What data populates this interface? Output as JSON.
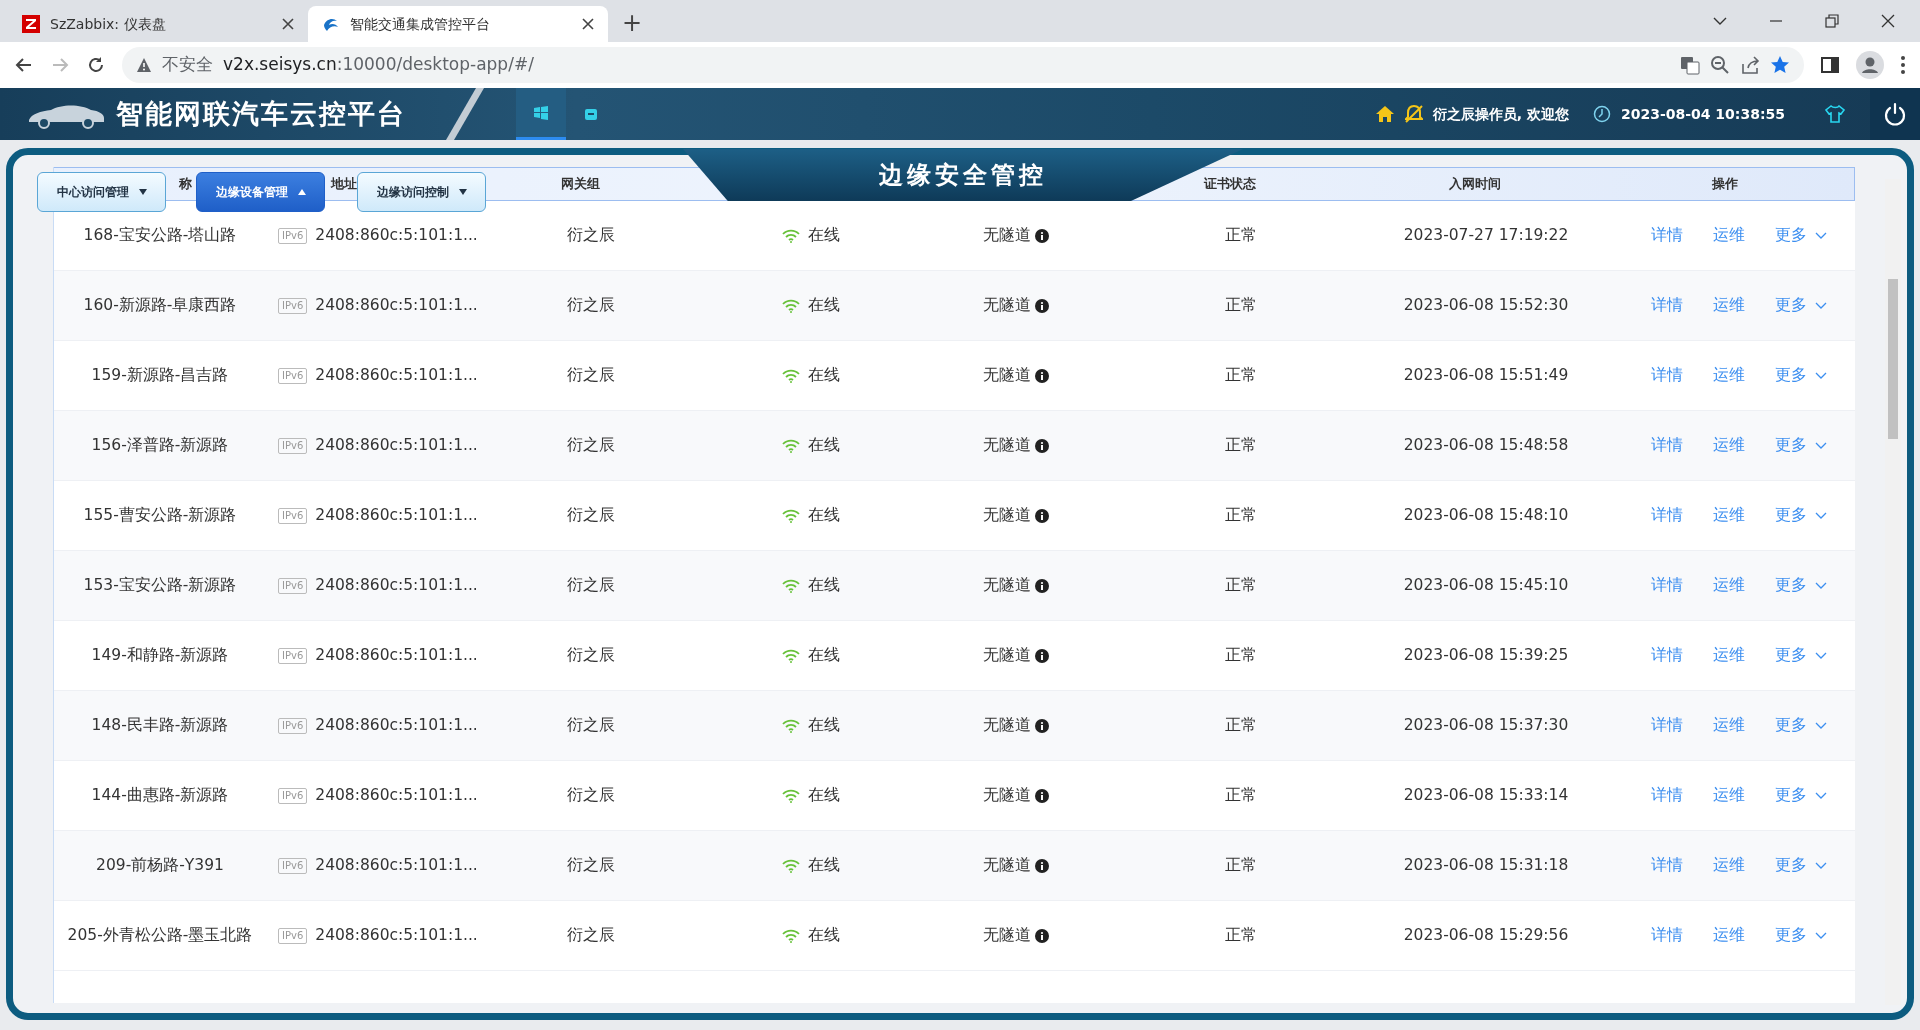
{
  "browser": {
    "tabs": [
      {
        "title": "SzZabbix: 仪表盘",
        "selected": false
      },
      {
        "title": "智能交通集成管控平台",
        "selected": true
      }
    ],
    "new_tab": "+",
    "address": {
      "security": "不安全",
      "host": "v2x.seisys.cn",
      "path": ":10000/desktop-app/#/"
    }
  },
  "app_header": {
    "title": "智能网联汽车云控平台",
    "nav": [
      {
        "selected": true
      },
      {
        "selected": false
      }
    ],
    "greeting": "衍之辰操作员, 欢迎您",
    "datetime": "2023-08-04 10:38:55"
  },
  "panel": {
    "title": "边缘安全管控",
    "menu_buttons": [
      {
        "label": "中心访问管理",
        "selected": false,
        "expanded": false
      },
      {
        "label": "边缘设备管理",
        "selected": true,
        "expanded": true
      },
      {
        "label": "边缘访问控制",
        "selected": false,
        "expanded": false
      }
    ],
    "columns": [
      {
        "label": "称"
      },
      {
        "label": "地址"
      },
      {
        "label": "网关组"
      },
      {
        "label": "证书状态"
      },
      {
        "label": "入网时间"
      },
      {
        "label": "操作"
      }
    ],
    "rows": [
      {
        "name": "168-宝安公路-塔山路",
        "protocol": "IPv6",
        "address": "2408:860c:5:101:1...",
        "gateway": "衍之辰",
        "online": true,
        "status": "在线",
        "tunnel": "无隧道",
        "cert": "正常",
        "joined": "2023-07-27 17:19:22",
        "actions": [
          "详情",
          "运维",
          "更多"
        ]
      },
      {
        "name": "160-新源路-阜康西路",
        "protocol": "IPv6",
        "address": "2408:860c:5:101:1...",
        "gateway": "衍之辰",
        "online": true,
        "status": "在线",
        "tunnel": "无隧道",
        "cert": "正常",
        "joined": "2023-06-08 15:52:30",
        "actions": [
          "详情",
          "运维",
          "更多"
        ]
      },
      {
        "name": "159-新源路-昌吉路",
        "protocol": "IPv6",
        "address": "2408:860c:5:101:1...",
        "gateway": "衍之辰",
        "online": true,
        "status": "在线",
        "tunnel": "无隧道",
        "cert": "正常",
        "joined": "2023-06-08 15:51:49",
        "actions": [
          "详情",
          "运维",
          "更多"
        ]
      },
      {
        "name": "156-泽普路-新源路",
        "protocol": "IPv6",
        "address": "2408:860c:5:101:1...",
        "gateway": "衍之辰",
        "online": true,
        "status": "在线",
        "tunnel": "无隧道",
        "cert": "正常",
        "joined": "2023-06-08 15:48:58",
        "actions": [
          "详情",
          "运维",
          "更多"
        ]
      },
      {
        "name": "155-曹安公路-新源路",
        "protocol": "IPv6",
        "address": "2408:860c:5:101:1...",
        "gateway": "衍之辰",
        "online": true,
        "status": "在线",
        "tunnel": "无隧道",
        "cert": "正常",
        "joined": "2023-06-08 15:48:10",
        "actions": [
          "详情",
          "运维",
          "更多"
        ]
      },
      {
        "name": "153-宝安公路-新源路",
        "protocol": "IPv6",
        "address": "2408:860c:5:101:1...",
        "gateway": "衍之辰",
        "online": true,
        "status": "在线",
        "tunnel": "无隧道",
        "cert": "正常",
        "joined": "2023-06-08 15:45:10",
        "actions": [
          "详情",
          "运维",
          "更多"
        ]
      },
      {
        "name": "149-和静路-新源路",
        "protocol": "IPv6",
        "address": "2408:860c:5:101:1...",
        "gateway": "衍之辰",
        "online": true,
        "status": "在线",
        "tunnel": "无隧道",
        "cert": "正常",
        "joined": "2023-06-08 15:39:25",
        "actions": [
          "详情",
          "运维",
          "更多"
        ]
      },
      {
        "name": "148-民丰路-新源路",
        "protocol": "IPv6",
        "address": "2408:860c:5:101:1...",
        "gateway": "衍之辰",
        "online": true,
        "status": "在线",
        "tunnel": "无隧道",
        "cert": "正常",
        "joined": "2023-06-08 15:37:30",
        "actions": [
          "详情",
          "运维",
          "更多"
        ]
      },
      {
        "name": "144-曲惠路-新源路",
        "protocol": "IPv6",
        "address": "2408:860c:5:101:1...",
        "gateway": "衍之辰",
        "online": true,
        "status": "在线",
        "tunnel": "无隧道",
        "cert": "正常",
        "joined": "2023-06-08 15:33:14",
        "actions": [
          "详情",
          "运维",
          "更多"
        ]
      },
      {
        "name": "209-前杨路-Y391",
        "protocol": "IPv6",
        "address": "2408:860c:5:101:1...",
        "gateway": "衍之辰",
        "online": true,
        "status": "在线",
        "tunnel": "无隧道",
        "cert": "正常",
        "joined": "2023-06-08 15:31:18",
        "actions": [
          "详情",
          "运维",
          "更多"
        ]
      },
      {
        "name": "205-外青松公路-墨玉北路",
        "protocol": "IPv6",
        "address": "2408:860c:5:101:1...",
        "gateway": "衍之辰",
        "online": true,
        "status": "在线",
        "tunnel": "无隧道",
        "cert": "正常",
        "joined": "2023-06-08 15:29:56",
        "actions": [
          "详情",
          "运维",
          "更多"
        ]
      }
    ]
  }
}
